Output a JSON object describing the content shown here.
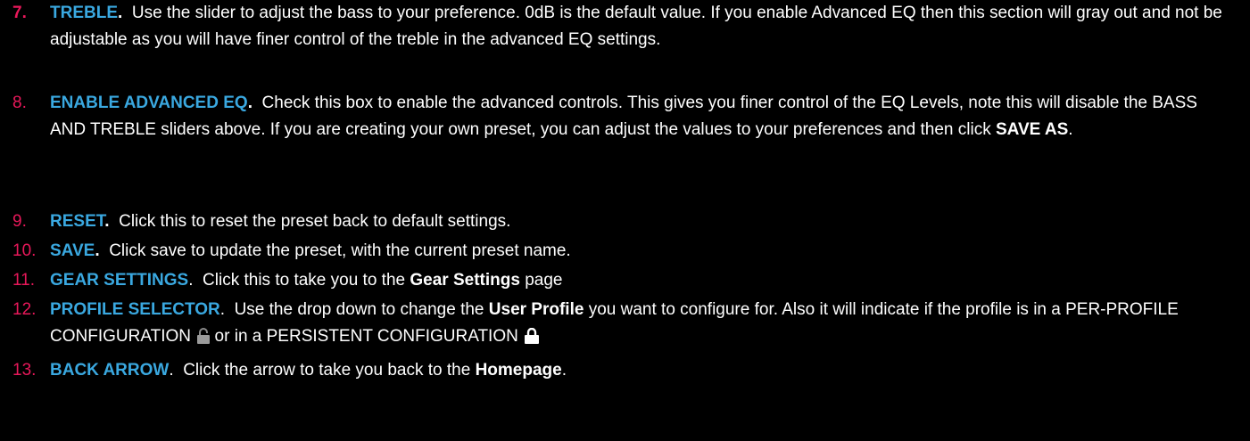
{
  "colors": {
    "background": "#000000",
    "number": "#e8185a",
    "keyword": "#3aa8e0",
    "text": "#ffffff"
  },
  "items": [
    {
      "number": "7.",
      "title": "TREBLE",
      "title_punct": ".",
      "text": "Use the slider to adjust the bass to your preference.  0dB is the default value.  If you enable Advanced EQ then this section will gray out and not be adjustable as you will have finer control of the treble in the advanced EQ settings."
    },
    {
      "number": "8.",
      "title": "ENABLE ADVANCED EQ",
      "title_punct": ".",
      "text_a": "Check this box to enable the advanced controls.  This gives you finer control of the EQ Levels, note this will disable the BASS AND TREBLE sliders above.  If you are creating your own preset, you can adjust the values to your preferences and then click ",
      "bold": "SAVE AS",
      "text_b": "."
    },
    {
      "number": "9.",
      "title": "RESET",
      "title_punct": ".",
      "text": "Click this to reset the preset back to default settings."
    },
    {
      "number": "10.",
      "title": "SAVE",
      "title_punct": ".",
      "text": "Click save to update the preset, with the current preset name."
    },
    {
      "number": "11.",
      "title": "GEAR SETTINGS",
      "title_punct": ".",
      "text_a": "Click this to take you to the ",
      "bold": "Gear Settings",
      "text_b": " page"
    },
    {
      "number": "12.",
      "title": "PROFILE SELECTOR",
      "title_punct": ".",
      "text_a": "Use the drop down to change the ",
      "bold": "User Profile",
      "text_b": " you want to configure for. Also it will indicate if the profile is in a PER-PROFILE CONFIGURATION ",
      "text_c": " or in a PERSISTENT CONFIGURATION ",
      "icons": [
        "unlocked-padlock-icon",
        "locked-padlock-icon"
      ]
    },
    {
      "number": "13.",
      "title": "BACK ARROW",
      "title_punct": ".",
      "text_a": "Click the arrow to take you back to the ",
      "bold": "Homepage",
      "text_b": "."
    }
  ]
}
